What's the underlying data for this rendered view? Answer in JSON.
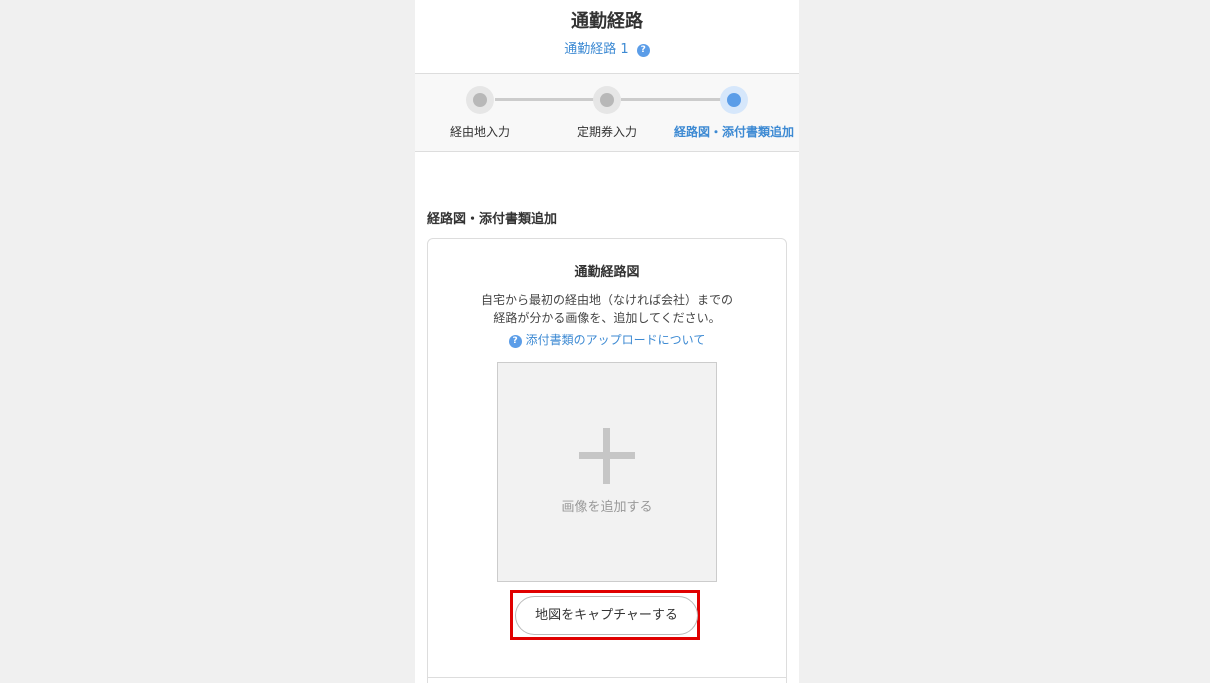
{
  "header": {
    "title": "通勤経路",
    "subtitle": "通勤経路 1",
    "help_glyph": "?"
  },
  "stepper": {
    "steps": [
      {
        "label": "経由地入力",
        "state": "done"
      },
      {
        "label": "定期券入力",
        "state": "done"
      },
      {
        "label": "経路図・添付書類追加",
        "state": "active"
      }
    ]
  },
  "section": {
    "title": "経路図・添付書類追加"
  },
  "card": {
    "title": "通勤経路図",
    "desc_line1": "自宅から最初の経由地（なければ会社）までの",
    "desc_line2": "経路が分かる画像を、追加してください。",
    "help_glyph": "?",
    "link_label": "添付書類のアップロードについて",
    "upload_label": "画像を追加する",
    "capture_button": "地図をキャプチャーする"
  },
  "colors": {
    "accent": "#3d8ad3",
    "active_step": "#5b9de8",
    "highlight": "#e00000",
    "page_bg": "#f0f0f0"
  },
  "icons": [
    "help-icon",
    "plus-icon"
  ]
}
